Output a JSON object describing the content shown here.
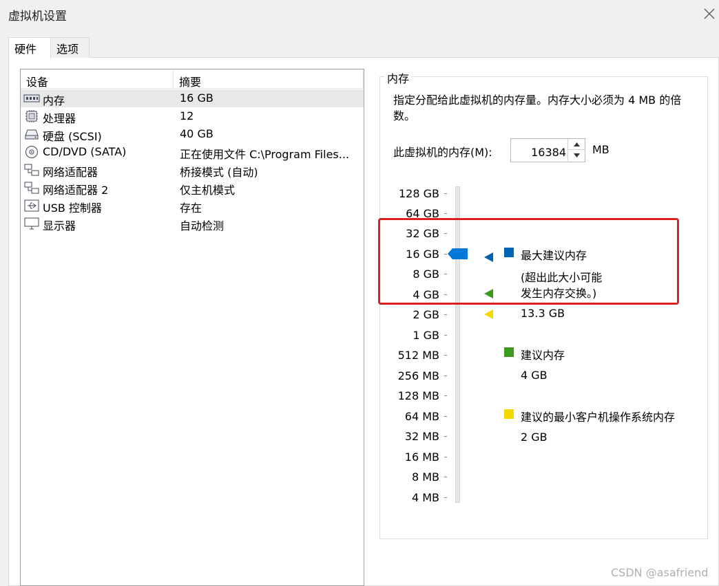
{
  "window": {
    "title": "虚拟机设置"
  },
  "tabs": [
    {
      "label": "硬件"
    },
    {
      "label": "选项"
    }
  ],
  "device_list": {
    "headers": {
      "device": "设备",
      "summary": "摘要"
    },
    "rows": [
      {
        "name": "内存",
        "summary": "16 GB",
        "icon": "memory-icon"
      },
      {
        "name": "处理器",
        "summary": "12",
        "icon": "processor-icon"
      },
      {
        "name": "硬盘 (SCSI)",
        "summary": "40 GB",
        "icon": "hard-disk-icon"
      },
      {
        "name": "CD/DVD (SATA)",
        "summary": "正在使用文件 C:\\Program Files...",
        "icon": "cd-dvd-icon"
      },
      {
        "name": "网络适配器",
        "summary": "桥接模式 (自动)",
        "icon": "network-adapter-icon"
      },
      {
        "name": "网络适配器 2",
        "summary": "仅主机模式",
        "icon": "network-adapter-icon"
      },
      {
        "name": "USB 控制器",
        "summary": "存在",
        "icon": "usb-icon"
      },
      {
        "name": "显示器",
        "summary": "自动检测",
        "icon": "monitor-icon"
      }
    ]
  },
  "memory": {
    "group_title": "内存",
    "description": "指定分配给此虚拟机的内存量。内存大小必须为 4 MB 的倍数。",
    "label": "此虚拟机的内存(M):",
    "value": "16384",
    "unit": "MB",
    "scale": [
      "128 GB",
      "64 GB",
      "32 GB",
      "16 GB",
      "8 GB",
      "4 GB",
      "2 GB",
      "1 GB",
      "512 MB",
      "256 MB",
      "128 MB",
      "64 MB",
      "32 MB",
      "16 MB",
      "8 MB",
      "4 MB"
    ],
    "slider_value": "16 GB",
    "legend": {
      "max_recommended": {
        "label": "最大建议内存",
        "note_line1": "(超出此大小可能",
        "note_line2": "发生内存交换。)",
        "value": "13.3 GB",
        "color": "#0063b1"
      },
      "recommended": {
        "label": "建议内存",
        "value": "4 GB",
        "color": "#3c9a1e"
      },
      "min_guest": {
        "label": "建议的最小客户机操作系统内存",
        "value": "2 GB",
        "color": "#f5d800"
      }
    }
  },
  "watermark": "CSDN @asafriend",
  "colors": {
    "highlight_box": "#e02020",
    "slider_thumb": "#0078d7"
  }
}
